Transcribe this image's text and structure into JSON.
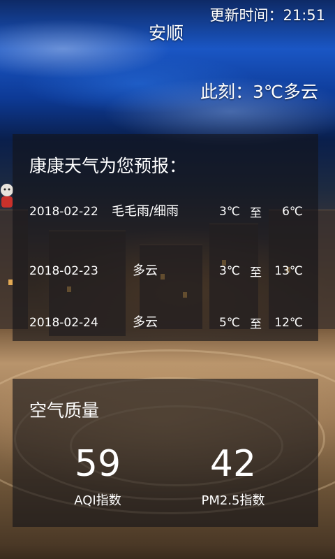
{
  "header": {
    "update_time": "更新时间：21:51",
    "city": "安顺",
    "current": "此刻：3℃多云"
  },
  "forecast": {
    "title": "康康天气为您预报：",
    "to_label": "至",
    "rows": [
      {
        "date": "2018-02-22",
        "condition": "毛毛雨/细雨",
        "low": "3℃",
        "high": "6℃"
      },
      {
        "date": "2018-02-23",
        "condition": "多云",
        "low": "3℃",
        "high": "13℃"
      },
      {
        "date": "2018-02-24",
        "condition": "多云",
        "low": "5℃",
        "high": "12℃"
      }
    ]
  },
  "air_quality": {
    "title": "空气质量",
    "aqi": {
      "value": "59",
      "label": "AQI指数"
    },
    "pm25": {
      "value": "42",
      "label": "PM2.5指数"
    }
  }
}
